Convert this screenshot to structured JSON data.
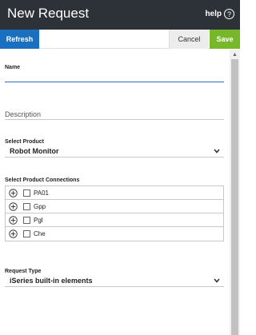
{
  "header": {
    "title": "New Request",
    "help_label": "help",
    "help_icon": "question-circle-icon"
  },
  "toolbar": {
    "refresh_label": "Refresh",
    "cancel_label": "Cancel",
    "save_label": "Save"
  },
  "form": {
    "name_label": "Name",
    "name_value": "",
    "description_placeholder": "Description",
    "product_label": "Select Product",
    "product_value": "Robot Monitor",
    "connections_label": "Select Product Connections",
    "connections": [
      {
        "name": "PA01",
        "checked": false
      },
      {
        "name": "Gpp",
        "checked": false
      },
      {
        "name": "Pgl",
        "checked": false
      },
      {
        "name": "Che",
        "checked": false
      }
    ],
    "request_type_label": "Request Type",
    "request_type_value": "iSeries built-in elements"
  },
  "colors": {
    "header_bg": "#2d3238",
    "refresh_bg": "#1a6fbf",
    "save_bg": "#76b82a",
    "cancel_bg": "#ececec",
    "focus_underline": "#2a6eb5"
  }
}
